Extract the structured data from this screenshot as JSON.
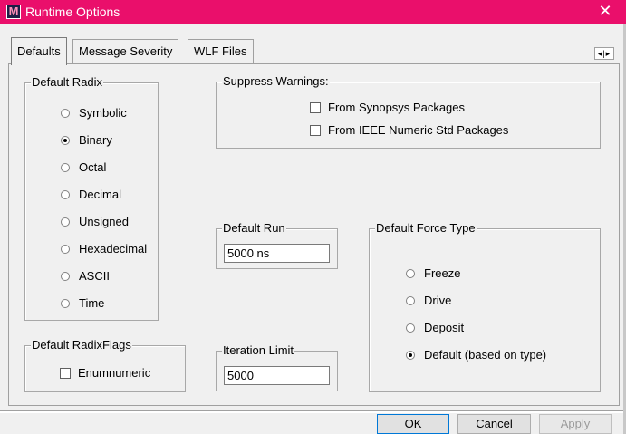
{
  "window": {
    "title": "Runtime Options",
    "app_icon": "M"
  },
  "tabs": [
    {
      "label": "Defaults",
      "active": true
    },
    {
      "label": "Message Severity",
      "active": false
    },
    {
      "label": "WLF Files",
      "active": false
    }
  ],
  "tab_scroll": "◂|▸",
  "default_radix": {
    "legend": "Default Radix",
    "options": [
      "Symbolic",
      "Binary",
      "Octal",
      "Decimal",
      "Unsigned",
      "Hexadecimal",
      "ASCII",
      "Time"
    ],
    "selected": "Binary"
  },
  "default_radixflags": {
    "legend": "Default RadixFlags",
    "enumnumeric": {
      "label": "Enumnumeric",
      "checked": false
    }
  },
  "suppress_warnings": {
    "legend": "Suppress Warnings:",
    "synopsys": {
      "label": "From Synopsys Packages",
      "checked": false
    },
    "ieee": {
      "label": "From IEEE Numeric Std Packages",
      "checked": false
    }
  },
  "default_run": {
    "legend": "Default Run",
    "value": "5000 ns"
  },
  "iteration_limit": {
    "legend": "Iteration Limit",
    "value": "5000"
  },
  "default_force_type": {
    "legend": "Default Force Type",
    "options": [
      "Freeze",
      "Drive",
      "Deposit",
      "Default (based on type)"
    ],
    "selected": "Default (based on type)"
  },
  "buttons": {
    "ok": "OK",
    "cancel": "Cancel",
    "apply": "Apply"
  },
  "colors": {
    "titlebar": "#ea0f6b",
    "panel": "#f0f0f0",
    "default_button_border": "#0078d7"
  }
}
